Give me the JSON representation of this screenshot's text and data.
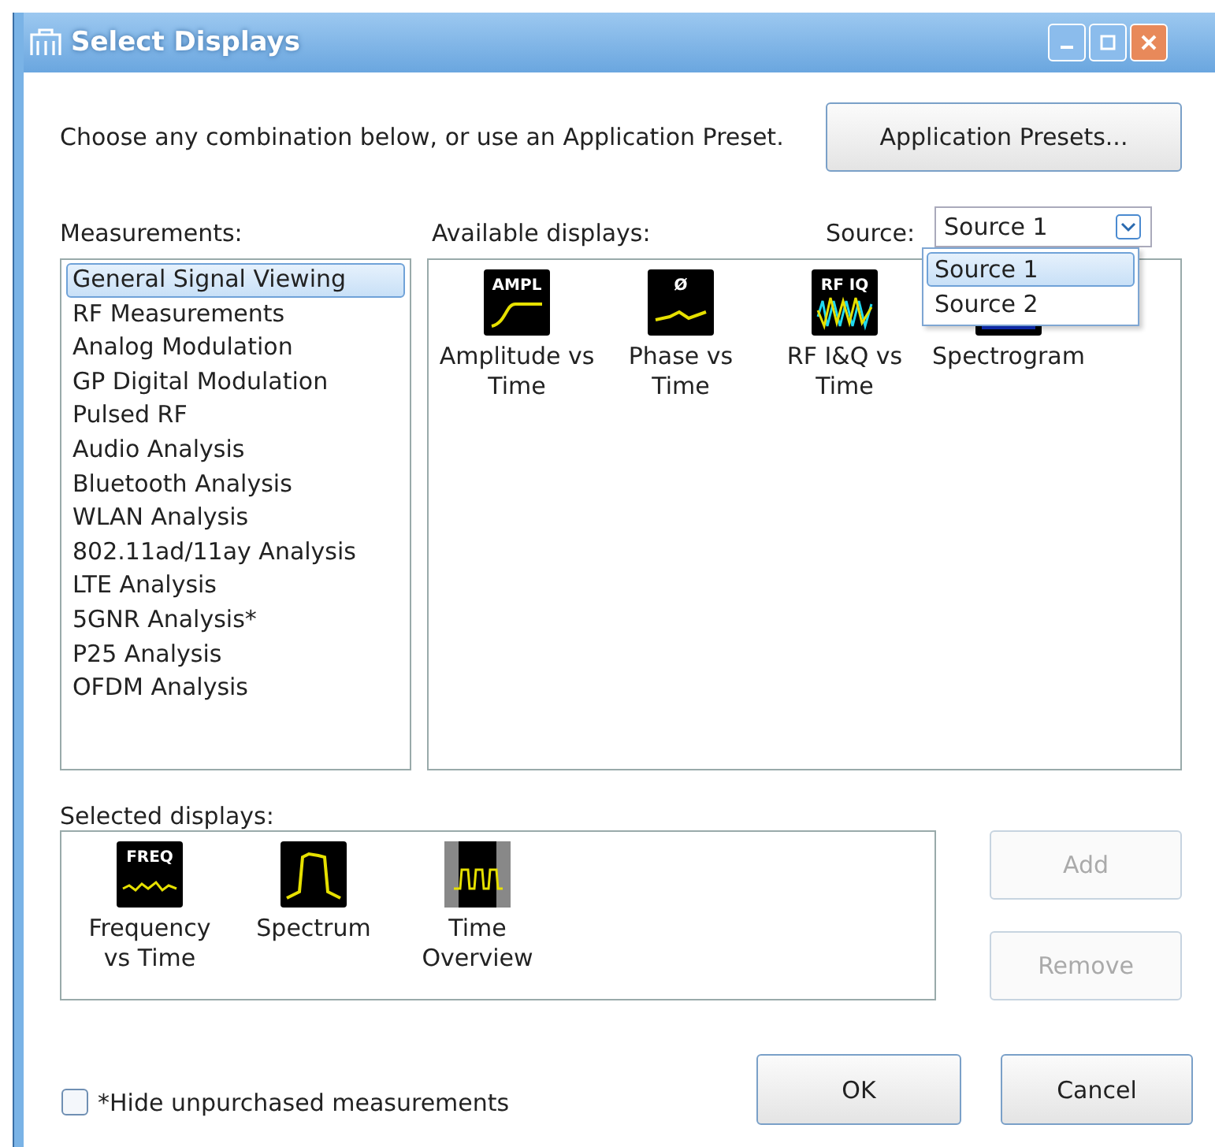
{
  "window": {
    "title": "Select Displays"
  },
  "intro": "Choose any combination below, or use an Application Preset.",
  "presets_button": "Application Presets...",
  "measurements": {
    "label": "Measurements:",
    "items": [
      {
        "label": "General Signal Viewing",
        "selected": true
      },
      {
        "label": "RF Measurements",
        "selected": false
      },
      {
        "label": "Analog Modulation",
        "selected": false
      },
      {
        "label": "GP Digital Modulation",
        "selected": false
      },
      {
        "label": "Pulsed RF",
        "selected": false
      },
      {
        "label": "Audio Analysis",
        "selected": false
      },
      {
        "label": "Bluetooth Analysis",
        "selected": false
      },
      {
        "label": "WLAN Analysis",
        "selected": false
      },
      {
        "label": "802.11ad/11ay Analysis",
        "selected": false
      },
      {
        "label": "LTE Analysis",
        "selected": false
      },
      {
        "label": "5GNR Analysis*",
        "selected": false
      },
      {
        "label": "P25 Analysis",
        "selected": false
      },
      {
        "label": "OFDM Analysis",
        "selected": false
      }
    ]
  },
  "available": {
    "label": "Available displays:",
    "items": [
      {
        "kind": "ampl",
        "icon_text": "AMPL",
        "label": "Amplitude vs\nTime"
      },
      {
        "kind": "phase",
        "icon_text": "Ø",
        "label": "Phase vs\nTime"
      },
      {
        "kind": "rfiq",
        "icon_text": "RF IQ",
        "label": "RF I&Q vs\nTime"
      },
      {
        "kind": "spectrogram",
        "label": "Spectrogram"
      }
    ]
  },
  "source": {
    "label": "Source:",
    "value": "Source 1",
    "expanded": true,
    "options": [
      {
        "label": "Source 1",
        "selected": true
      },
      {
        "label": "Source 2",
        "selected": false
      }
    ]
  },
  "selected_displays": {
    "label": "Selected displays:",
    "items": [
      {
        "kind": "freq",
        "icon_text": "FREQ",
        "label": "Frequency\nvs Time"
      },
      {
        "kind": "spectrum",
        "label": "Spectrum"
      },
      {
        "kind": "time_overview",
        "label": "Time\nOverview"
      }
    ]
  },
  "add_button": {
    "label": "Add",
    "disabled": true
  },
  "remove_button": {
    "label": "Remove",
    "disabled": true
  },
  "hide_unpurchased": {
    "label": "*Hide unpurchased measurements",
    "checked": false
  },
  "ok_button": "OK",
  "cancel_button": "Cancel"
}
